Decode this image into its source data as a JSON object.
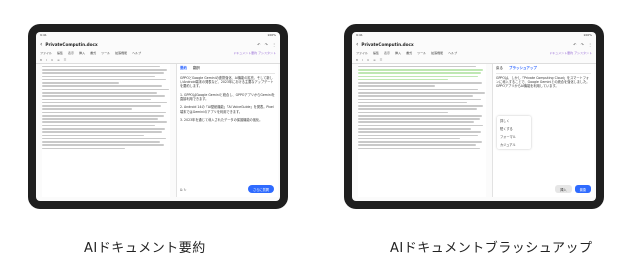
{
  "left_tablet": {
    "status_time": "9:41",
    "status_right": "100%",
    "doc_title": "PrivateComputin.docx",
    "menu": [
      "ファイル",
      "編集",
      "表示",
      "挿入",
      "書式",
      "ツール",
      "拡張機能",
      "ヘルプ"
    ],
    "ai_menu": "ドキュメント要約 アシスタント",
    "panel": {
      "tab_active": "要約",
      "tab_other": "翻訳",
      "text": "GPPOとGoogle Geminiの連携強化、AI機能の拡充、そして新しいAndroid端末の発表など、2023年における主要なアップデートを要約します。\n\n1. GPPOはGoogle Geminiと統合し、GPPOアプリからGeminiを直接利用できます。\n\n2. Android 14の「AI壁紙機能」「AI VoiceGuide」を発表。Pixel端末ではGeminiのアプリを利用できます。\n\n3. 2023年を通じて導入されたデータの保護機能の強化。",
      "send_button": "さらに質問"
    }
  },
  "right_tablet": {
    "status_time": "9:41",
    "status_right": "100%",
    "doc_title": "PrivateComputin.docx",
    "menu": [
      "ファイル",
      "編集",
      "表示",
      "挿入",
      "書式",
      "ツール",
      "拡張機能",
      "ヘルプ"
    ],
    "ai_menu": "ドキュメント要約 アシスタント",
    "panel": {
      "tab_active": "ブラッシュアップ",
      "tab_other": "戻る",
      "text": "GPPOは、しかし「Private Computing Cloud」をスマートフォンに導入することで、Google Geminiとの統合を強化しました。GPPOアプリからAI機能を利用しています。",
      "menu_items": [
        "詳しく",
        "短くする",
        "フォーマル",
        "カジュアル"
      ],
      "insert_button": "挿入",
      "replace_button": "置換"
    }
  },
  "captions": {
    "left": "AIドキュメント要約",
    "right": "AIドキュメントブラッシュアップ"
  }
}
